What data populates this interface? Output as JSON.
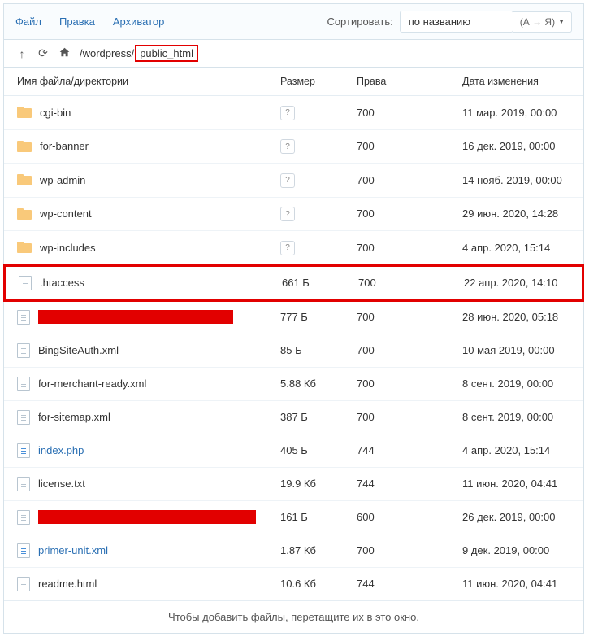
{
  "menu": {
    "file": "Файл",
    "edit": "Правка",
    "archiver": "Архиватор"
  },
  "sort": {
    "label": "Сортировать:",
    "by": "по названию",
    "order": "(А → Я)"
  },
  "breadcrumb": {
    "seg1": "/wordpress/",
    "seg2": "public_html"
  },
  "columns": {
    "name": "Имя файла/директории",
    "size": "Размер",
    "perm": "Права",
    "date": "Дата изменения"
  },
  "files": [
    {
      "type": "folder",
      "name": "cgi-bin",
      "size": "?",
      "perm": "700",
      "date": "11 мар. 2019, 00:00"
    },
    {
      "type": "folder",
      "name": "for-banner",
      "size": "?",
      "perm": "700",
      "date": "16 дек. 2019, 00:00"
    },
    {
      "type": "folder",
      "name": "wp-admin",
      "size": "?",
      "perm": "700",
      "date": "14 нояб. 2019, 00:00"
    },
    {
      "type": "folder",
      "name": "wp-content",
      "size": "?",
      "perm": "700",
      "date": "29 июн. 2020, 14:28"
    },
    {
      "type": "folder",
      "name": "wp-includes",
      "size": "?",
      "perm": "700",
      "date": "4 апр. 2020, 15:14"
    },
    {
      "type": "file",
      "name": ".htaccess",
      "size": "661 Б",
      "perm": "700",
      "date": "22 апр. 2020, 14:10",
      "highlighted": true
    },
    {
      "type": "file",
      "name": "",
      "redacted": true,
      "redwidth": 240,
      "size": "777 Б",
      "perm": "700",
      "date": "28 июн. 2020, 05:18"
    },
    {
      "type": "file",
      "name": "BingSiteAuth.xml",
      "size": "85 Б",
      "perm": "700",
      "date": "10 мая 2019, 00:00"
    },
    {
      "type": "file",
      "name": "for-merchant-ready.xml",
      "size": "5.88 Кб",
      "perm": "700",
      "date": "8 сент. 2019, 00:00"
    },
    {
      "type": "file",
      "name": "for-sitemap.xml",
      "size": "387 Б",
      "perm": "700",
      "date": "8 сент. 2019, 00:00"
    },
    {
      "type": "file-blue",
      "name": "index.php",
      "size": "405 Б",
      "perm": "744",
      "date": "4 апр. 2020, 15:14"
    },
    {
      "type": "file",
      "name": "license.txt",
      "size": "19.9 Кб",
      "perm": "744",
      "date": "11 июн. 2020, 04:41"
    },
    {
      "type": "file",
      "name": "",
      "redacted": true,
      "redwidth": 268,
      "size": "161 Б",
      "perm": "600",
      "date": "26 дек. 2019, 00:00"
    },
    {
      "type": "file-blue",
      "name": "primer-unit.xml",
      "size": "1.87 Кб",
      "perm": "700",
      "date": "9 дек. 2019, 00:00"
    },
    {
      "type": "file",
      "name": "readme.html",
      "size": "10.6 Кб",
      "perm": "744",
      "date": "11 июн. 2020, 04:41",
      "last": true
    }
  ],
  "footer": "Чтобы добавить файлы, перетащите их в это окно."
}
